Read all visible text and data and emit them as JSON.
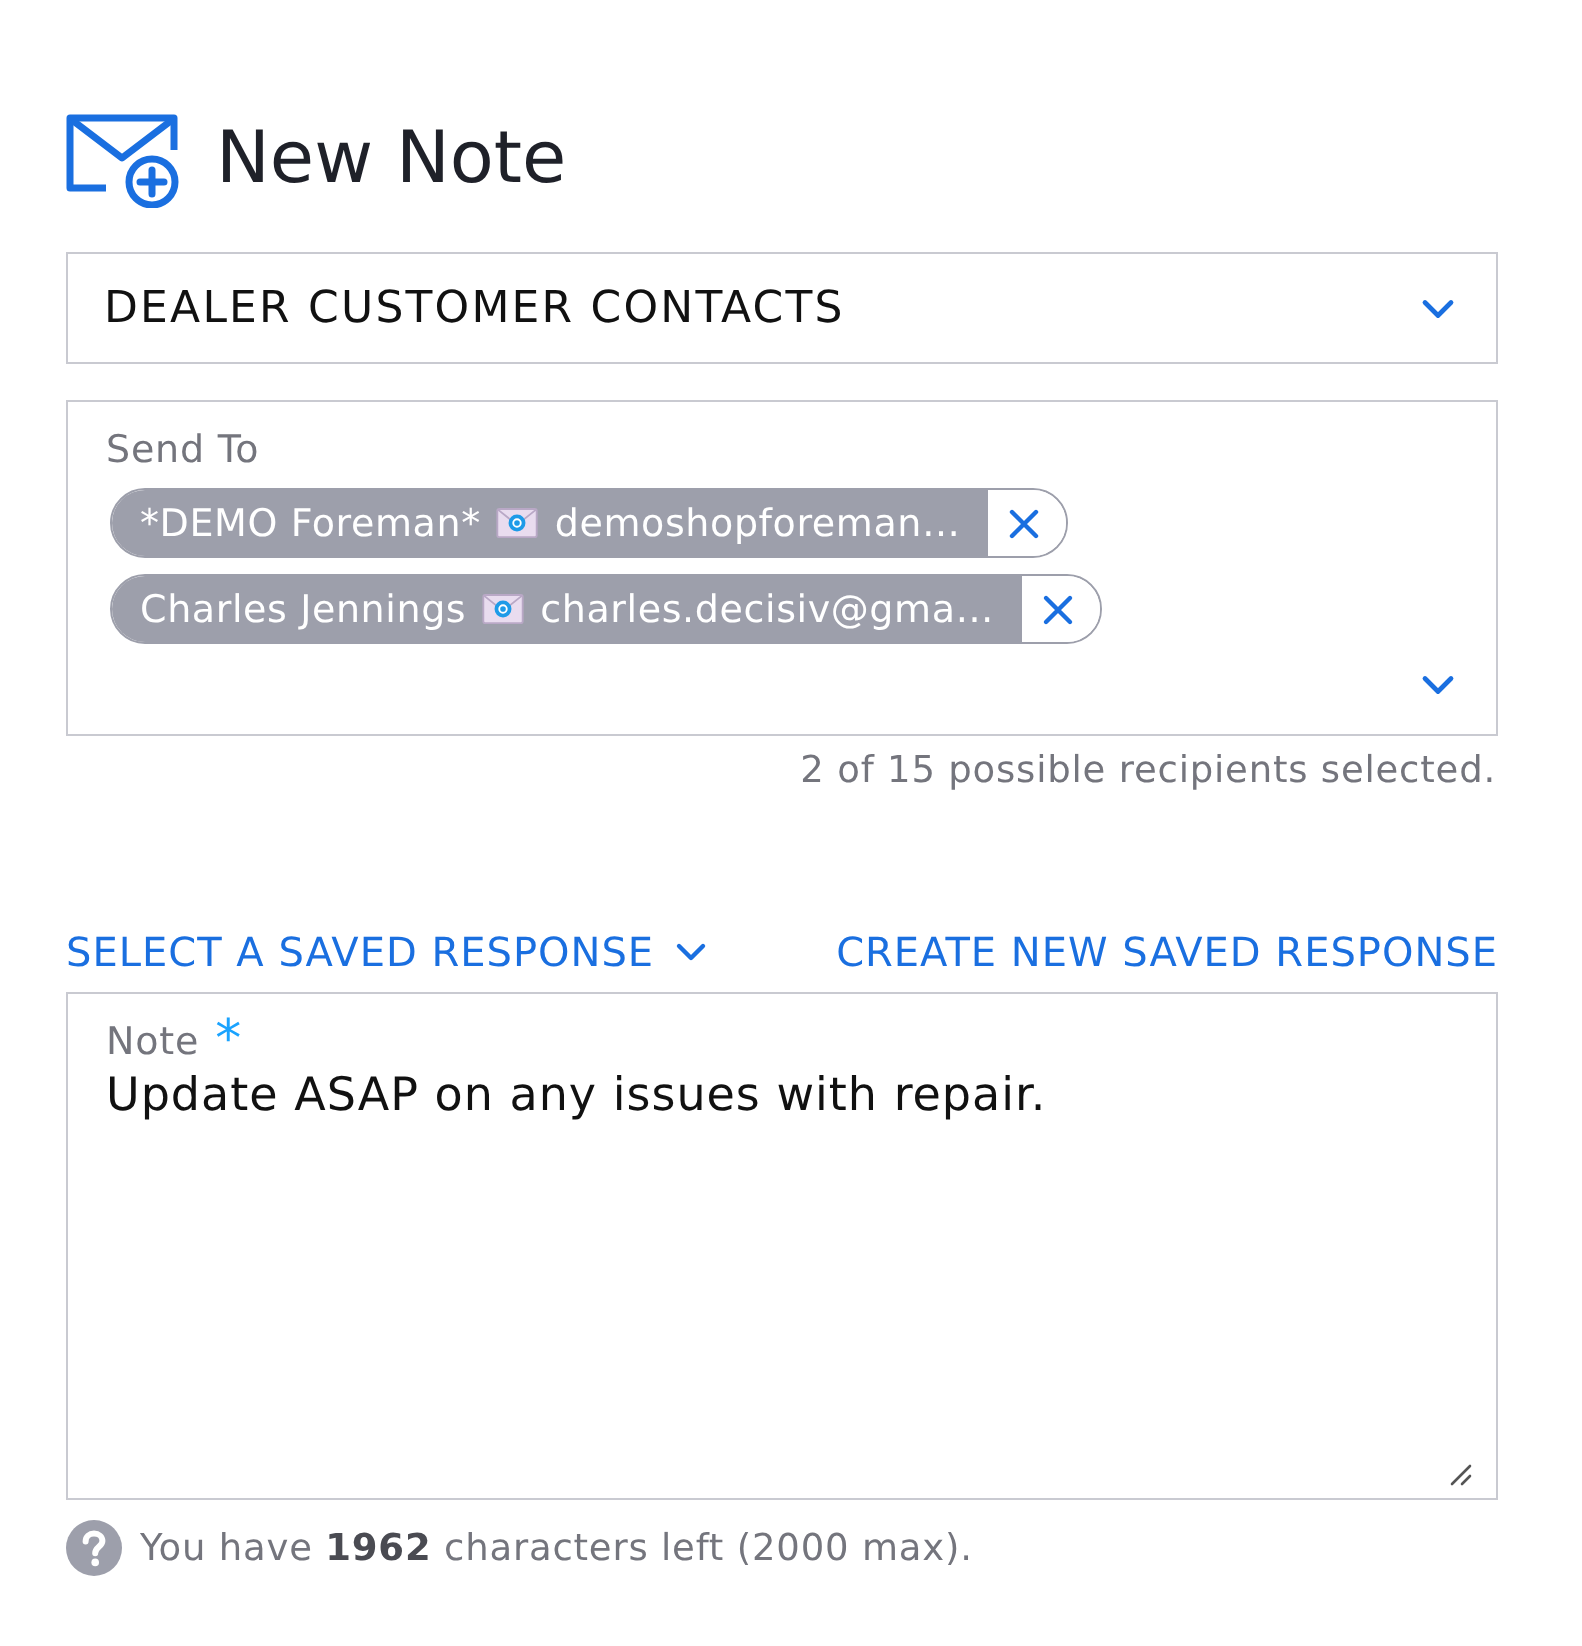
{
  "header": {
    "title": "New Note"
  },
  "contact_list": {
    "value": "DEALER CUSTOMER CONTACTS"
  },
  "send_to": {
    "label": "Send To",
    "recipients": [
      {
        "name": "*DEMO Foreman*",
        "email": "demoshopforeman…"
      },
      {
        "name": "Charles Jennings",
        "email": "charles.decisiv@gma…"
      }
    ],
    "summary": "2 of 15 possible recipients selected."
  },
  "saved_responses": {
    "select_label": "SELECT A SAVED RESPONSE",
    "create_label": "CREATE NEW SAVED RESPONSE"
  },
  "note": {
    "label": "Note",
    "required_mark": "*",
    "value": "Update ASAP on any issues with repair."
  },
  "footer": {
    "hint": "You have **1962** characters left (2000 max)."
  }
}
